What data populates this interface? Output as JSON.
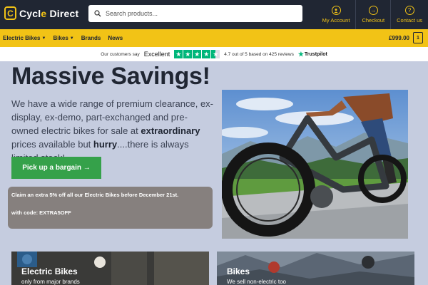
{
  "header": {
    "logo_prefix": "Cycl",
    "logo_accent": "e",
    "logo_suffix": " Direct",
    "logo_mark": "C",
    "search_placeholder": "Search products...",
    "actions": [
      {
        "label": "My Account",
        "icon": "user-icon"
      },
      {
        "label": "Checkout",
        "icon": "arrow-right-icon"
      },
      {
        "label": "Contact us",
        "icon": "question-icon"
      }
    ]
  },
  "nav": {
    "items": [
      {
        "label": "Electric Bikes",
        "has_dropdown": true
      },
      {
        "label": "Bikes",
        "has_dropdown": true
      },
      {
        "label": "Brands",
        "has_dropdown": false
      },
      {
        "label": "News",
        "has_dropdown": false
      }
    ],
    "cart_total": "£999.00",
    "cart_count": "1"
  },
  "trust": {
    "intro": "Our customers say",
    "rating_word": "Excellent",
    "stars": 4.5,
    "summary": "4.7 out of 5 based on 425 reviews",
    "brand": "Trustpilot"
  },
  "hero": {
    "title": "Massive Savings!",
    "desc_1": "We have a wide range of premium clearance, ex-display, ex-demo, part-exchanged and pre-owned electric bikes for sale at ",
    "desc_bold_1": "extraordinary",
    "desc_2": " prices available but ",
    "desc_bold_2": "hurry",
    "desc_3": "....there is always limited stock!",
    "cta_label": "Pick up a bargain →",
    "promo_line1": "Claim an extra 5% off all our Electric Bikes before December 21st.",
    "promo_line2": "with code: EXTRA5OFF"
  },
  "cards": [
    {
      "title": "Electric Bikes",
      "subtitle": "only from major brands"
    },
    {
      "title": "Bikes",
      "subtitle": "We sell non-electric too"
    }
  ],
  "colors": {
    "dark": "#202633",
    "accent": "#f2c316",
    "hero_bg": "#c5ccdf",
    "cta": "#35a14a",
    "trustpilot": "#00b67a"
  }
}
